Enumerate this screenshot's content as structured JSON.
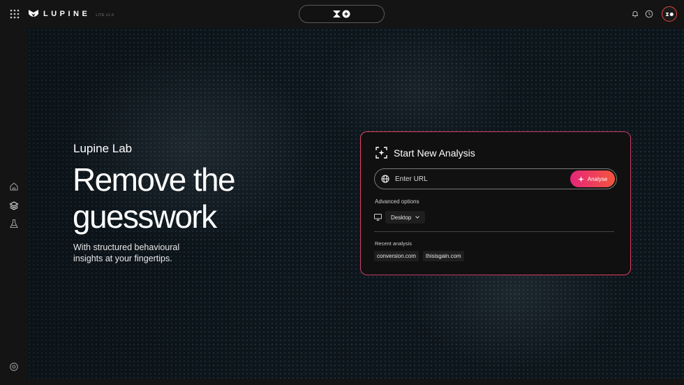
{
  "app": {
    "name": "LUPINE",
    "version": "LITE v1.0"
  },
  "topbar": {
    "grid_icon": "grid-icon",
    "center_logo_icon": "xa-logo-icon",
    "notification_icon": "bell-icon",
    "history_icon": "clock-icon",
    "avatar_icon": "xa-logo-icon"
  },
  "sidebar": {
    "items": [
      {
        "icon": "home-icon"
      },
      {
        "icon": "layers-icon"
      },
      {
        "icon": "flask-icon"
      }
    ],
    "settings_icon": "gear-icon"
  },
  "hero": {
    "lab_title": "Lupine Lab",
    "headline_line1": "Remove the",
    "headline_line2": "guesswork",
    "subtext_line1": "With structured behavioural",
    "subtext_line2": "insights at your fingertips."
  },
  "analysis_card": {
    "title": "Start New Analysis",
    "url_placeholder": "Enter URL",
    "url_value": "",
    "analyse_label": "Analyse",
    "advanced_label": "Advanced options",
    "device_selected": "Desktop",
    "recent_label": "Recent analysis",
    "recent_items": [
      "conversion.com",
      "thisisgain.com"
    ]
  },
  "colors": {
    "accent_start": "#e5267a",
    "accent_end": "#f4553d",
    "card_border": "#e8425f",
    "avatar_border": "#e4443f",
    "background": "#141414"
  }
}
